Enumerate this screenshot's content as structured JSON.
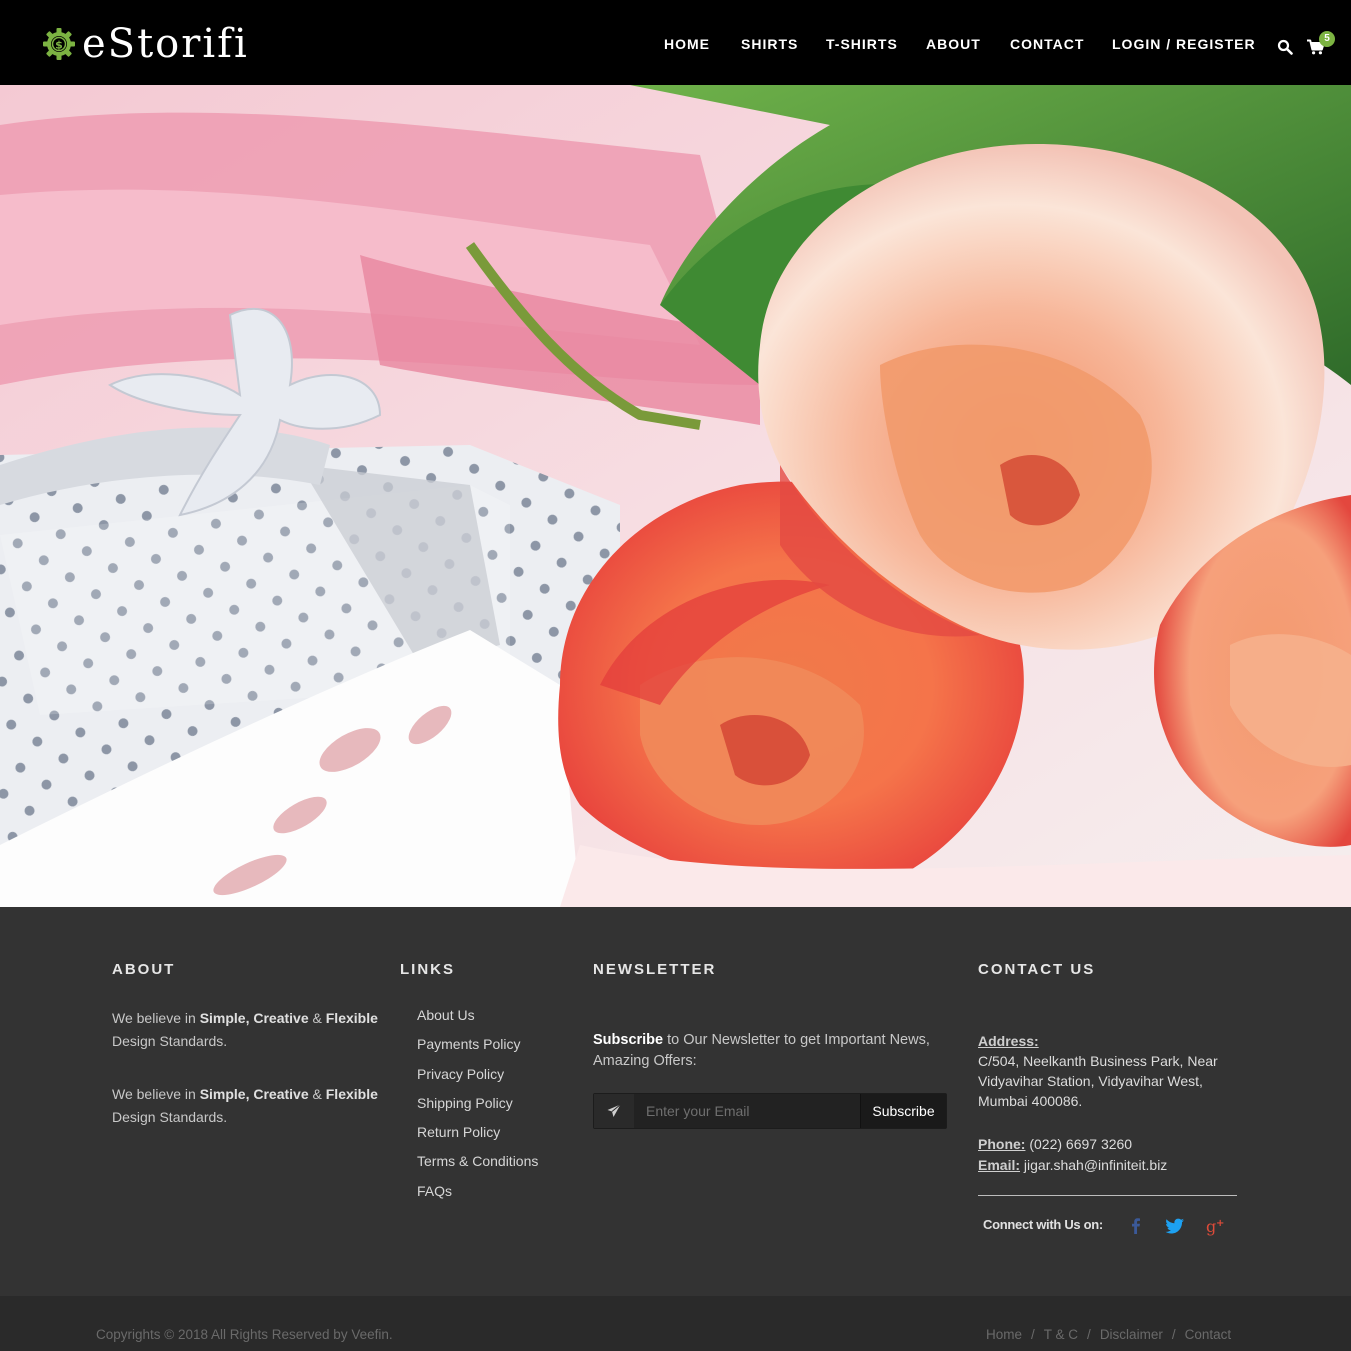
{
  "header": {
    "logo_text": "eStorifi",
    "nav": [
      "HOME",
      "SHIRTS",
      "T-SHIRTS",
      "ABOUT",
      "CONTACT",
      "LOGIN / REGISTER"
    ],
    "cart_count": "5"
  },
  "footer": {
    "about": {
      "title": "ABOUT",
      "p1_prefix": "We believe in ",
      "p1_strong1": "Simple, Creative",
      "p1_amp": " & ",
      "p1_strong2": "Flexible",
      "p1_suffix": " Design Standards.",
      "p2_prefix": "We believe in ",
      "p2_strong1": "Simple, Creative",
      "p2_amp": " & ",
      "p2_strong2": "Flexible",
      "p2_suffix": " Design Standards."
    },
    "links": {
      "title": "LINKS",
      "items": [
        "About Us",
        "Payments Policy",
        "Privacy Policy",
        "Shipping Policy",
        "Return Policy",
        "Terms & Conditions",
        "FAQs"
      ]
    },
    "newsletter": {
      "title": "NEWSLETTER",
      "strong": "Subscribe",
      "text": " to Our Newsletter to get Important News, Amazing Offers:",
      "placeholder": "Enter your Email",
      "button": "Subscribe"
    },
    "contact": {
      "title": "CONTACT US",
      "address_label": "Address:",
      "address": "C/504, Neelkanth Business Park, Near Vidyavihar Station, Vidyavihar West, Mumbai 400086.",
      "phone_label": "Phone:",
      "phone": " (022) 6697 3260",
      "email_label": "Email:",
      "email": " jigar.shah@infiniteit.biz",
      "connect": "Connect with Us on:"
    }
  },
  "bottom": {
    "copyright": "Copyrights © 2018 All Rights Reserved by Veefin.",
    "links": [
      "Home",
      "T & C",
      "Disclaimer",
      "Contact"
    ],
    "separator": "/"
  },
  "colors": {
    "header_bg": "#000000",
    "footer_bg": "#333333",
    "bottom_bg": "#2a2a2a",
    "logo_accent": "#7cb342",
    "facebook": "#3b5998",
    "twitter": "#1da1f2",
    "google_plus": "#dd4b39"
  },
  "icons": [
    "dollar-gear-icon",
    "search-icon",
    "cart-icon",
    "paper-plane-icon",
    "facebook-icon",
    "twitter-icon",
    "google-plus-icon"
  ]
}
